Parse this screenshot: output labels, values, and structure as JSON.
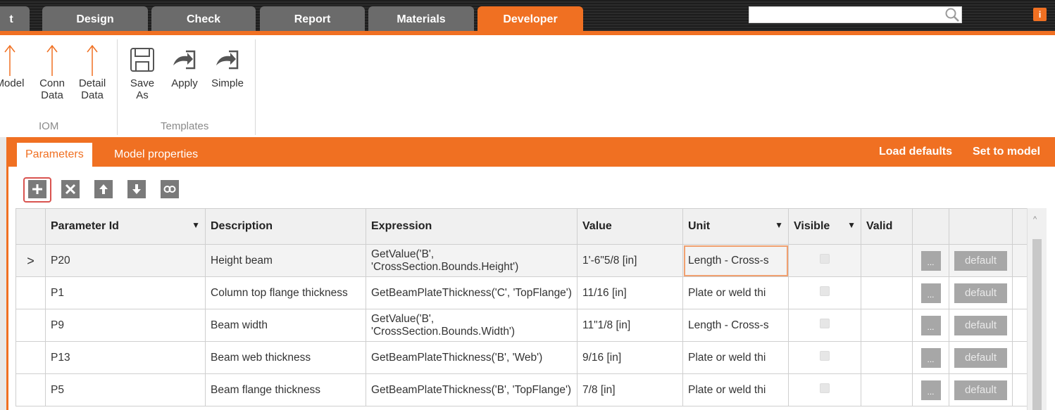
{
  "tabs": [
    {
      "label": "t",
      "active": false
    },
    {
      "label": "Design",
      "active": false
    },
    {
      "label": "Check",
      "active": false
    },
    {
      "label": "Report",
      "active": false
    },
    {
      "label": "Materials",
      "active": false
    },
    {
      "label": "Developer",
      "active": true
    }
  ],
  "search": {
    "placeholder": "",
    "icon": "search-icon"
  },
  "info_label": "i",
  "ribbon": {
    "iom": {
      "label": "IOM",
      "buttons": [
        {
          "line1": "Model",
          "line2": "",
          "icon": "arrow-up-icon"
        },
        {
          "line1": "Conn",
          "line2": "Data",
          "icon": "arrow-up-icon"
        },
        {
          "line1": "Detail",
          "line2": "Data",
          "icon": "arrow-up-icon"
        }
      ]
    },
    "templates": {
      "label": "Templates",
      "buttons": [
        {
          "line1": "Save",
          "line2": "As",
          "icon": "save-icon"
        },
        {
          "line1": "Apply",
          "line2": "",
          "icon": "apply-arrow-icon"
        },
        {
          "line1": "Simple",
          "line2": "",
          "icon": "apply-arrow-icon"
        }
      ]
    }
  },
  "panel": {
    "tabs": [
      {
        "label": "Parameters",
        "active": true
      },
      {
        "label": "Model properties",
        "active": false
      }
    ],
    "load_defaults": "Load defaults",
    "set_to_model": "Set to model"
  },
  "table": {
    "columns": [
      "",
      "Parameter Id",
      "Description",
      "Expression",
      "Value",
      "Unit",
      "Visible",
      "Valid",
      "",
      ""
    ],
    "rows": [
      {
        "id": "P20",
        "description": "Height beam",
        "expression": "GetValue('B', 'CrossSection.Bounds.Height')",
        "value": "1'-6\"5/8 [in]",
        "unit": "Length - Cross-s",
        "selected": true
      },
      {
        "id": "P1",
        "description": "Column top flange thickness",
        "expression": "GetBeamPlateThickness('C', 'TopFlange')",
        "value": "11/16 [in]",
        "unit": "Plate or weld thi",
        "selected": false
      },
      {
        "id": "P9",
        "description": "Beam width",
        "expression": "GetValue('B', 'CrossSection.Bounds.Width')",
        "value": "11\"1/8 [in]",
        "unit": "Length - Cross-s",
        "selected": false
      },
      {
        "id": "P13",
        "description": "Beam web thickness",
        "expression": "GetBeamPlateThickness('B', 'Web')",
        "value": "9/16 [in]",
        "unit": "Plate or weld thi",
        "selected": false
      },
      {
        "id": "P5",
        "description": "Beam flange thickness",
        "expression": "GetBeamPlateThickness('B', 'TopFlange')",
        "value": "7/8 [in]",
        "unit": "Plate or weld thi",
        "selected": false
      }
    ],
    "dots_label": "...",
    "default_label": "default",
    "row_marker": ">"
  },
  "colors": {
    "accent": "#f07022",
    "tab_inactive": "#6b6b6b",
    "button_gray": "#a7a7a7"
  }
}
